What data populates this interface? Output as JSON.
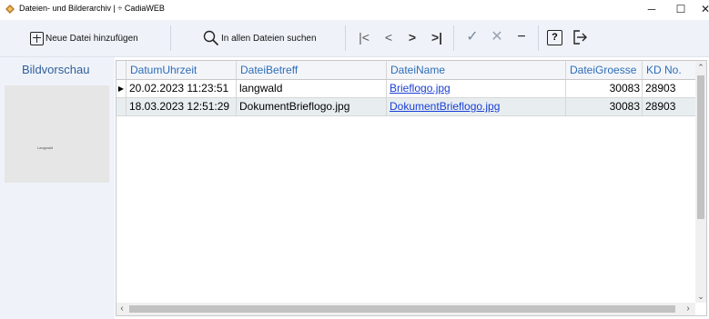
{
  "window": {
    "title": "Dateien- und Bilderarchiv | ÷ CadiaWEB",
    "icon": "app-logo-icon",
    "controls": {
      "minimize": "─",
      "maximize": "☐",
      "close": "✕"
    }
  },
  "toolbar": {
    "new_file_label": "Neue Datei hinzufügen",
    "search_all_label": "In allen Dateien suchen",
    "nav": {
      "first": "|<",
      "prev": "<",
      "next": ">",
      "last": ">|"
    },
    "actions": {
      "confirm": "✓",
      "cancel": "✕",
      "delete": "−"
    },
    "help": "?"
  },
  "preview": {
    "title": "Bildvorschau",
    "logo_text": "Langwald"
  },
  "grid": {
    "columns": [
      "DatumUhrzeit",
      "DateiBetreff",
      "DateiName",
      "DateiGroesse",
      "KD No."
    ],
    "rows": [
      {
        "selected": true,
        "datum": "20.02.2023 11:23:51",
        "betreff": "langwald",
        "name": "Brieflogo.jpg",
        "groesse": "30083",
        "kd": "28903"
      },
      {
        "selected": false,
        "datum": "18.03.2023 12:51:29",
        "betreff": "DokumentBrieflogo.jpg",
        "name": "DokumentBrieflogo.jpg",
        "groesse": "30083",
        "kd": "28903"
      }
    ]
  },
  "colors": {
    "accent": "#2d6db8",
    "link": "#1a3fd6",
    "panel_bg": "#eff3f9"
  }
}
